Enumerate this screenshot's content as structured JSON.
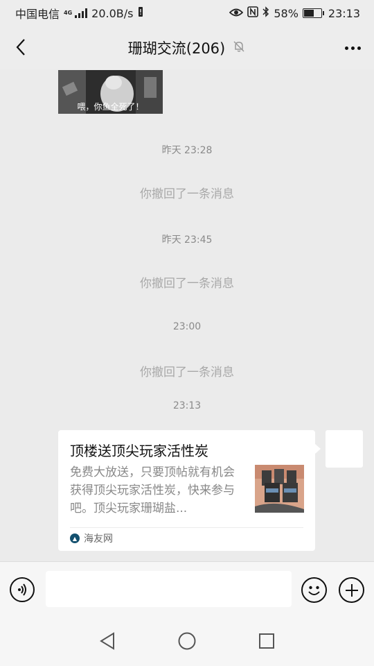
{
  "status_bar": {
    "carrier": "中国电信",
    "network": "4G",
    "speed": "20.0B/s",
    "battery_percent": "58%",
    "battery_level": 0.58,
    "time": "23:13"
  },
  "header": {
    "title": "珊瑚交流(206)",
    "icons": [
      "back-icon",
      "mute-bell-icon",
      "more-icon"
    ]
  },
  "chat": {
    "image_message": {
      "caption": "喂，你鱼全死了！"
    },
    "items": [
      {
        "time": "昨天 23:28",
        "system": "你撤回了一条消息"
      },
      {
        "time": "昨天 23:45",
        "system": "你撤回了一条消息"
      },
      {
        "time": "23:00",
        "system": "你撤回了一条消息"
      },
      {
        "time": "23:13"
      }
    ],
    "link_card": {
      "title": "顶楼送顶尖玩家活性炭",
      "description": "免费大放送，只要顶帖就有机会获得顶尖玩家活性炭，快来参与吧。顶尖玩家珊瑚盐...",
      "source": "海友网"
    }
  },
  "input_bar": {
    "placeholder": "",
    "icons": [
      "voice-icon",
      "emoji-icon",
      "plus-icon"
    ]
  },
  "nav_bar": {
    "icons": [
      "back-triangle-icon",
      "home-circle-icon",
      "recents-square-icon"
    ]
  },
  "colors": {
    "background": "#ebebeb",
    "bar": "#ededed",
    "card": "#ffffff",
    "muted_text": "#a8a8a8"
  }
}
